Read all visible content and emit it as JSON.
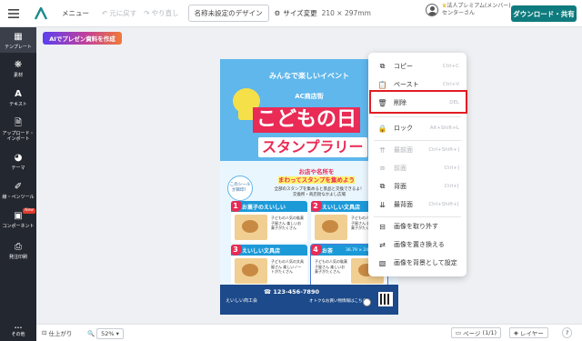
{
  "header": {
    "menu_label": "メニュー",
    "undo_label": "元に戻す",
    "redo_label": "やり直し",
    "doc_title": "名称未設定のデザイン",
    "size_label": "サイズ変更",
    "size_value": "210 × 297mm",
    "user_plan": "法人プレミアム(メンバー)",
    "user_name": "センターさん",
    "download_label": "ダウンロード・共有"
  },
  "sidebar": {
    "items": [
      {
        "label": "テンプレート",
        "icon": "template-icon"
      },
      {
        "label": "素材",
        "icon": "material-icon"
      },
      {
        "label": "テキスト",
        "icon": "text-icon"
      },
      {
        "label": "アップロード・インポート",
        "icon": "upload-icon"
      },
      {
        "label": "テーマ",
        "icon": "theme-icon"
      },
      {
        "label": "線・ペンツール",
        "icon": "pen-icon"
      },
      {
        "label": "コンポーネント",
        "icon": "component-icon",
        "badge": "New"
      },
      {
        "label": "発注印刷",
        "icon": "print-icon"
      }
    ],
    "more_label": "その他"
  },
  "ai_button": "AIでプレゼン資料を作成",
  "poster": {
    "top_text": "みんなで楽しいイベント",
    "shop": "AC商店街",
    "title1": "こどもの日",
    "title2": "スタンプラリー",
    "call_line1": "お店や名所を",
    "call_line2": "まわってスタンプを集めよう",
    "sub_line1": "全部のスタンプを集めると景品と交換できるよ！",
    "sub_line2": "交換所・商店街なかよし広場",
    "circle_text": "このシールが目印！",
    "cards": [
      {
        "num": "1",
        "title": "お菓子のえいしい",
        "text": "子どもの人気の駄菓子屋さん 楽しいお菓子がたくさん"
      },
      {
        "num": "2",
        "title": "えいしい文具店",
        "text": "子どもの人気の駄菓子屋さん 楽しいお菓子がたくさん"
      },
      {
        "num": "3",
        "title": "えいしい文具店",
        "text": "子どもの人気の文具屋さん 楽しいノートがたくさん"
      },
      {
        "num": "4",
        "title": "お茶",
        "text": "子どもの人気の駄菓子屋さん 楽しいお菓子がたくさん"
      }
    ],
    "card4_extra": "36.79 × 24",
    "tel": "123-456-7890",
    "footer_name": "えいしい商工会",
    "footer_note": "オトクなお買い物情報はこちら"
  },
  "context_menu": {
    "items": [
      {
        "label": "コピー",
        "shortcut": "Ctrl+C",
        "icon": "copy-icon",
        "enabled": true
      },
      {
        "label": "ペースト",
        "shortcut": "Ctrl+V",
        "icon": "paste-icon",
        "enabled": true
      },
      {
        "label": "削除",
        "shortcut": "DEL",
        "icon": "trash-icon",
        "enabled": true
      },
      {
        "label": "ロック",
        "shortcut": "Alt+Shift+L",
        "icon": "lock-icon",
        "enabled": true
      },
      {
        "label": "最前面",
        "shortcut": "Ctrl+Shift+]",
        "icon": "bring-to-front-icon",
        "enabled": false
      },
      {
        "label": "前面",
        "shortcut": "Ctrl+]",
        "icon": "bring-forward-icon",
        "enabled": false
      },
      {
        "label": "背面",
        "shortcut": "Ctrl+[",
        "icon": "send-backward-icon",
        "enabled": true
      },
      {
        "label": "最背面",
        "shortcut": "Ctrl+Shift+[",
        "icon": "send-to-back-icon",
        "enabled": true
      },
      {
        "label": "画像を取り外す",
        "shortcut": "",
        "icon": "detach-image-icon",
        "enabled": true
      },
      {
        "label": "画像を置き換える",
        "shortcut": "",
        "icon": "replace-image-icon",
        "enabled": true
      },
      {
        "label": "画像を背景として設定",
        "shortcut": "",
        "icon": "set-background-icon",
        "enabled": true
      }
    ]
  },
  "bottom": {
    "finish_label": "仕上がり",
    "zoom_value": "52%",
    "page_label": "ページ",
    "page_count": "(1/1)",
    "layer_label": "レイヤー",
    "help_label": "?"
  },
  "colors": {
    "accent": "#0f7b7e",
    "sidebar_bg": "#23272f",
    "highlight": "#e21c23",
    "poster_bg": "#5fb7ec",
    "poster_pink": "#e92b55"
  }
}
